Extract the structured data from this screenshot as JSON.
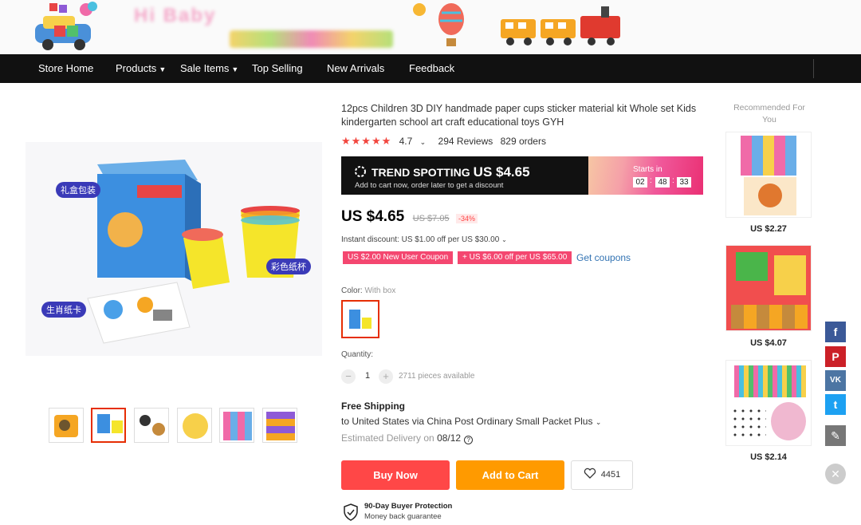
{
  "banner": {
    "store_name": "Hi Baby"
  },
  "nav": {
    "items": [
      {
        "label": "Store Home",
        "has_dropdown": false
      },
      {
        "label": "Products",
        "has_dropdown": true
      },
      {
        "label": "Sale Items",
        "has_dropdown": true
      },
      {
        "label": "Top Selling",
        "has_dropdown": false
      },
      {
        "label": "New Arrivals",
        "has_dropdown": false
      },
      {
        "label": "Feedback",
        "has_dropdown": false
      }
    ]
  },
  "gallery": {
    "image_labels": [
      "礼盒包装",
      "彩色纸杯",
      "生肖纸卡"
    ],
    "thumb_count": 6,
    "active_thumb": 2
  },
  "product": {
    "title": "12pcs Children 3D DIY handmade paper cups sticker material kit Whole set Kids kindergarten school art craft educational toys GYH",
    "stars": "★★★★★",
    "rating": "4.7",
    "reviews": "294 Reviews",
    "orders": "829 orders"
  },
  "promo": {
    "title": "TREND SPOTTING",
    "price": "US $4.65",
    "subtitle": "Add to cart now, order later to get a discount",
    "starts_label": "Starts in",
    "timer": [
      "02",
      "48",
      "33"
    ]
  },
  "pricing": {
    "price": "US $4.65",
    "old_price": "US $7.05",
    "discount": "-34%",
    "instant_discount": "Instant discount: US $1.00 off per US $30.00",
    "coupons": [
      "US $2.00 New User Coupon",
      "+ US $6.00 off per US $65.00"
    ],
    "get_coupons": "Get coupons"
  },
  "options": {
    "color_label": "Color:",
    "color_value": "With box",
    "quantity_label": "Quantity:",
    "quantity": "1",
    "available": "2711 pieces available"
  },
  "shipping": {
    "title": "Free Shipping",
    "destination": "to United States via China Post Ordinary Small Packet Plus",
    "estimated_label": "Estimated Delivery on",
    "estimated_date": "08/12"
  },
  "actions": {
    "buy_now": "Buy Now",
    "add_to_cart": "Add to Cart",
    "wishlist_count": "4451"
  },
  "protection": {
    "title": "90-Day Buyer Protection",
    "subtitle": "Money back guarantee"
  },
  "recommended": {
    "title": "Recommended For You",
    "items": [
      {
        "price": "US $2.27"
      },
      {
        "price": "US $4.07"
      },
      {
        "price": "US $2.14"
      }
    ]
  },
  "social": {
    "facebook": "f",
    "pinterest": "P",
    "vk": "VK",
    "twitter": "t"
  },
  "colors": {
    "accent": "#ff4747",
    "cart": "#ff9a00",
    "nav_bg": "#111111",
    "link": "#3273b3",
    "facebook": "#3b5998",
    "pinterest": "#cb2027",
    "vk": "#4c75a3",
    "twitter": "#1da1f2",
    "edit": "#777777"
  }
}
